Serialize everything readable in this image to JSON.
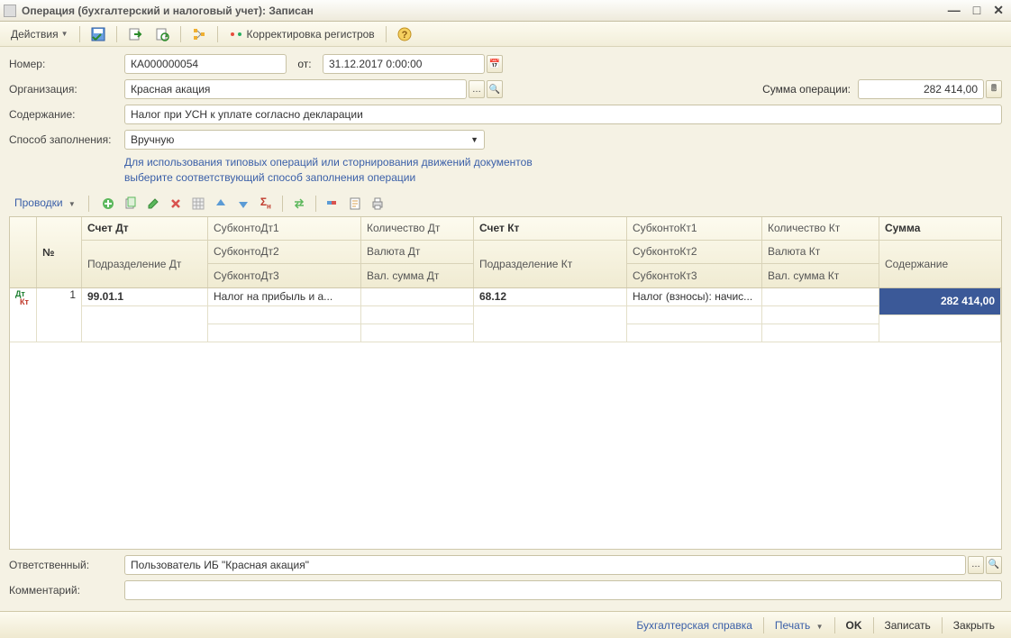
{
  "window": {
    "title": "Операция (бухгалтерский и налоговый учет): Записан"
  },
  "toolbar": {
    "actions": "Действия",
    "correction": "Корректировка регистров"
  },
  "form": {
    "number_label": "Номер:",
    "number": "КА000000054",
    "from_label": "от:",
    "date": "31.12.2017  0:00:00",
    "org_label": "Организация:",
    "org": "Красная акация",
    "sum_label": "Сумма операции:",
    "sum": "282 414,00",
    "content_label": "Содержание:",
    "content": "Налог при УСН к уплате согласно декларации",
    "method_label": "Способ заполнения:",
    "method": "Вручную",
    "hint1": "Для использования типовых операций или сторнирования движений документов",
    "hint2": "выберите соответствующий способ заполнения операции"
  },
  "tabs": {
    "entries": "Проводки"
  },
  "grid": {
    "headers": {
      "n": "№",
      "dt": "Счет Дт",
      "dt_div": "Подразделение Дт",
      "sdt1": "СубконтоДт1",
      "sdt2": "СубконтоДт2",
      "sdt3": "СубконтоДт3",
      "qdt": "Количество Дт",
      "cdt": "Валюта Дт",
      "vdt": "Вал. сумма Дт",
      "kt": "Счет Кт",
      "kt_div": "Подразделение Кт",
      "skt1": "СубконтоКт1",
      "skt2": "СубконтоКт2",
      "skt3": "СубконтоКт3",
      "qkt": "Количество Кт",
      "ckt": "Валюта Кт",
      "vkt": "Вал. сумма Кт",
      "sum": "Сумма",
      "desc": "Содержание"
    },
    "rows": [
      {
        "n": "1",
        "dt": "99.01.1",
        "sdt1": "Налог на прибыль и а...",
        "kt": "68.12",
        "skt1": "Налог (взносы): начис...",
        "sum": "282 414,00"
      }
    ]
  },
  "footer": {
    "resp_label": "Ответственный:",
    "resp": "Пользователь ИБ \"Красная акация\"",
    "comment_label": "Комментарий:",
    "comment": ""
  },
  "bottom": {
    "ref": "Бухгалтерская справка",
    "print": "Печать",
    "ok": "OK",
    "save": "Записать",
    "close": "Закрыть"
  }
}
